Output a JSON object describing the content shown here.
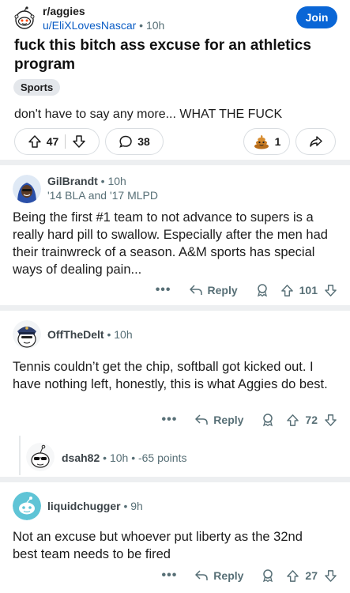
{
  "post": {
    "subreddit": "r/aggies",
    "author": "u/EliXLovesNascar",
    "age": "10h",
    "join_label": "Join",
    "title": "fuck this bitch ass excuse for an athletics program",
    "flair": "Sports",
    "body": "don't have to say any more... WHAT THE FUCK",
    "votes": "47",
    "comments": "38",
    "awards": "1"
  },
  "comments": [
    {
      "user": "GilBrandt",
      "age": "10h",
      "flair": "'14 BLA and '17 MLPD",
      "body": "Being the first #1 team to not advance to supers is a really hard pill to swallow. Especially after the men had their trainwreck of a season. A&M sports has special ways of dealing pain...",
      "reply_label": "Reply",
      "votes": "101",
      "more": "•••"
    },
    {
      "user": "OffTheDelt",
      "age": "10h",
      "body": "Tennis couldn’t get the chip, softball got kicked out. I have nothing left, honestly, this is what Aggies do best.",
      "reply_label": "Reply",
      "votes": "72",
      "more": "•••"
    },
    {
      "user": "dsah82",
      "age": "10h",
      "points": "-65 points"
    },
    {
      "user": "liquidchugger",
      "age": "9h",
      "body": "Not an excuse but whoever put liberty as the 32nd best team needs to be fired",
      "reply_label": "Reply",
      "votes": "27",
      "more": "•••"
    }
  ],
  "separator": "•",
  "colors": {
    "join": "#0a66d6",
    "author_link": "#0a5cc4",
    "meta": "#576f76",
    "divider": "#edeff1"
  }
}
